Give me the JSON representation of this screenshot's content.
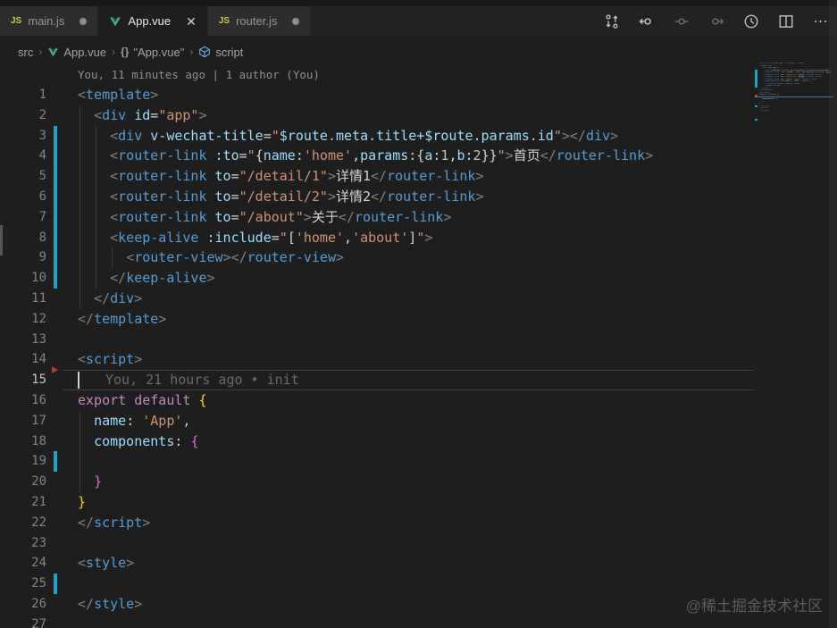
{
  "tabs": [
    {
      "label": "main.js",
      "icon": "js-icon",
      "state": "modified",
      "active": false
    },
    {
      "label": "App.vue",
      "icon": "vue-icon",
      "state": "open",
      "active": true
    },
    {
      "label": "router.js",
      "icon": "js-icon",
      "state": "modified",
      "active": false
    }
  ],
  "editor_actions": [
    {
      "name": "compare-changes"
    },
    {
      "name": "previous-change"
    },
    {
      "name": "change-disabled"
    },
    {
      "name": "next-change"
    },
    {
      "name": "timeline-history"
    },
    {
      "name": "split-editor"
    },
    {
      "name": "more-actions",
      "glyph": "⋯"
    }
  ],
  "breadcrumb": {
    "items": [
      {
        "label": "src",
        "icon": null
      },
      {
        "label": "App.vue",
        "icon": "vue-icon"
      },
      {
        "label": "\"App.vue\"",
        "icon": "braces-icon",
        "prefix": "{}"
      },
      {
        "label": "script",
        "icon": "symbol-module-icon"
      }
    ],
    "separator": "›"
  },
  "codelens_blame": "You, 11 minutes ago | 1 author (You)",
  "inline_blame_line15": "You, 21 hours ago • init",
  "watermark": "@稀土掘金技术社区",
  "colors": {
    "editor_bg": "#1e1e1e",
    "tab_inactive": "#2d2d2d",
    "tab_active": "#1e1e1e",
    "modified_gutter": "#1ea3c4",
    "deleted_gutter": "#b73b31",
    "tag": "#569cd6",
    "attr": "#9cdcfe",
    "string": "#ce9178",
    "keyword": "#c586c0",
    "number": "#b5cea8",
    "punct": "#808080",
    "vue_green": "#41b883",
    "js_yellow": "#cbcb41",
    "minimap_curline": "#2b7cb8"
  },
  "code": {
    "modified_lines": [
      3,
      4,
      5,
      6,
      7,
      8,
      9,
      10,
      19,
      25
    ],
    "deleted_marker_line": 15,
    "current_line": 15,
    "indent_guides": [
      {
        "col": 0,
        "from": 2,
        "to": 11
      },
      {
        "col": 2,
        "from": 3,
        "to": 10
      },
      {
        "col": 4,
        "from": 9,
        "to": 9
      },
      {
        "col": 0,
        "from": 17,
        "to": 20
      }
    ],
    "lines": [
      {
        "n": 1,
        "tokens": [
          [
            "p",
            "<"
          ],
          [
            "tag",
            "template"
          ],
          [
            "p",
            ">"
          ]
        ]
      },
      {
        "n": 2,
        "tokens": [
          [
            "op",
            "  "
          ],
          [
            "p",
            "<"
          ],
          [
            "tag",
            "div"
          ],
          [
            "op",
            " "
          ],
          [
            "attr",
            "id"
          ],
          [
            "op",
            "="
          ],
          [
            "str",
            "\"app\""
          ],
          [
            "p",
            ">"
          ]
        ]
      },
      {
        "n": 3,
        "tokens": [
          [
            "op",
            "    "
          ],
          [
            "p",
            "<"
          ],
          [
            "tag",
            "div"
          ],
          [
            "op",
            " "
          ],
          [
            "attr",
            "v-wechat-title"
          ],
          [
            "op",
            "="
          ],
          [
            "str",
            "\""
          ],
          [
            "attr",
            "$route.meta.title+$route.params.id"
          ],
          [
            "str",
            "\""
          ],
          [
            "p",
            "></"
          ],
          [
            "tag",
            "div"
          ],
          [
            "p",
            ">"
          ]
        ]
      },
      {
        "n": 4,
        "tokens": [
          [
            "op",
            "    "
          ],
          [
            "p",
            "<"
          ],
          [
            "tag",
            "router-link"
          ],
          [
            "op",
            " "
          ],
          [
            "attr",
            ":to"
          ],
          [
            "op",
            "="
          ],
          [
            "str",
            "\""
          ],
          [
            "op",
            "{"
          ],
          [
            "attr",
            "name"
          ],
          [
            "op",
            ":"
          ],
          [
            "str",
            "'home'"
          ],
          [
            "op",
            ","
          ],
          [
            "attr",
            "params"
          ],
          [
            "op",
            ":{"
          ],
          [
            "attr",
            "a"
          ],
          [
            "op",
            ":"
          ],
          [
            "num",
            "1"
          ],
          [
            "op",
            ","
          ],
          [
            "attr",
            "b"
          ],
          [
            "op",
            ":"
          ],
          [
            "num",
            "2"
          ],
          [
            "op",
            "}}"
          ],
          [
            "str",
            "\""
          ],
          [
            "p",
            ">"
          ],
          [
            "txt",
            "首页"
          ],
          [
            "p",
            "</"
          ],
          [
            "tag",
            "router-link"
          ],
          [
            "p",
            ">"
          ]
        ]
      },
      {
        "n": 5,
        "tokens": [
          [
            "op",
            "    "
          ],
          [
            "p",
            "<"
          ],
          [
            "tag",
            "router-link"
          ],
          [
            "op",
            " "
          ],
          [
            "attr",
            "to"
          ],
          [
            "op",
            "="
          ],
          [
            "str",
            "\"/detail/1\""
          ],
          [
            "p",
            ">"
          ],
          [
            "txt",
            "详情1"
          ],
          [
            "p",
            "</"
          ],
          [
            "tag",
            "router-link"
          ],
          [
            "p",
            ">"
          ]
        ]
      },
      {
        "n": 6,
        "tokens": [
          [
            "op",
            "    "
          ],
          [
            "p",
            "<"
          ],
          [
            "tag",
            "router-link"
          ],
          [
            "op",
            " "
          ],
          [
            "attr",
            "to"
          ],
          [
            "op",
            "="
          ],
          [
            "str",
            "\"/detail/2\""
          ],
          [
            "p",
            ">"
          ],
          [
            "txt",
            "详情2"
          ],
          [
            "p",
            "</"
          ],
          [
            "tag",
            "router-link"
          ],
          [
            "p",
            ">"
          ]
        ]
      },
      {
        "n": 7,
        "tokens": [
          [
            "op",
            "    "
          ],
          [
            "p",
            "<"
          ],
          [
            "tag",
            "router-link"
          ],
          [
            "op",
            " "
          ],
          [
            "attr",
            "to"
          ],
          [
            "op",
            "="
          ],
          [
            "str",
            "\"/about\""
          ],
          [
            "p",
            ">"
          ],
          [
            "txt",
            "关于"
          ],
          [
            "p",
            "</"
          ],
          [
            "tag",
            "router-link"
          ],
          [
            "p",
            ">"
          ]
        ]
      },
      {
        "n": 8,
        "tokens": [
          [
            "op",
            "    "
          ],
          [
            "p",
            "<"
          ],
          [
            "tag",
            "keep-alive"
          ],
          [
            "op",
            " "
          ],
          [
            "attr",
            ":include"
          ],
          [
            "op",
            "="
          ],
          [
            "str",
            "\""
          ],
          [
            "op",
            "["
          ],
          [
            "str",
            "'home'"
          ],
          [
            "op",
            ","
          ],
          [
            "str",
            "'about'"
          ],
          [
            "op",
            "]"
          ],
          [
            "str",
            "\""
          ],
          [
            "p",
            ">"
          ]
        ]
      },
      {
        "n": 9,
        "tokens": [
          [
            "op",
            "      "
          ],
          [
            "p",
            "<"
          ],
          [
            "tag",
            "router-view"
          ],
          [
            "p",
            "></"
          ],
          [
            "tag",
            "router-view"
          ],
          [
            "p",
            ">"
          ]
        ]
      },
      {
        "n": 10,
        "tokens": [
          [
            "op",
            "    "
          ],
          [
            "p",
            "</"
          ],
          [
            "tag",
            "keep-alive"
          ],
          [
            "p",
            ">"
          ]
        ]
      },
      {
        "n": 11,
        "tokens": [
          [
            "op",
            "  "
          ],
          [
            "p",
            "</"
          ],
          [
            "tag",
            "div"
          ],
          [
            "p",
            ">"
          ]
        ]
      },
      {
        "n": 12,
        "tokens": [
          [
            "p",
            "</"
          ],
          [
            "tag",
            "template"
          ],
          [
            "p",
            ">"
          ]
        ]
      },
      {
        "n": 13,
        "tokens": []
      },
      {
        "n": 14,
        "tokens": [
          [
            "p",
            "<"
          ],
          [
            "tag",
            "script"
          ],
          [
            "p",
            ">"
          ]
        ]
      },
      {
        "n": 15,
        "tokens": []
      },
      {
        "n": 16,
        "tokens": [
          [
            "kw",
            "export"
          ],
          [
            "op",
            " "
          ],
          [
            "kw",
            "default"
          ],
          [
            "op",
            " "
          ],
          [
            "b1",
            "{"
          ]
        ]
      },
      {
        "n": 17,
        "tokens": [
          [
            "op",
            "  "
          ],
          [
            "attr",
            "name"
          ],
          [
            "op",
            ": "
          ],
          [
            "str",
            "'App'"
          ],
          [
            "op",
            ","
          ]
        ]
      },
      {
        "n": 18,
        "tokens": [
          [
            "op",
            "  "
          ],
          [
            "attr",
            "components"
          ],
          [
            "op",
            ": "
          ],
          [
            "b2",
            "{"
          ]
        ]
      },
      {
        "n": 19,
        "tokens": []
      },
      {
        "n": 20,
        "tokens": [
          [
            "op",
            "  "
          ],
          [
            "b2",
            "}"
          ]
        ]
      },
      {
        "n": 21,
        "tokens": [
          [
            "b1",
            "}"
          ]
        ]
      },
      {
        "n": 22,
        "tokens": [
          [
            "p",
            "</"
          ],
          [
            "tag",
            "script"
          ],
          [
            "p",
            ">"
          ]
        ]
      },
      {
        "n": 23,
        "tokens": []
      },
      {
        "n": 24,
        "tokens": [
          [
            "p",
            "<"
          ],
          [
            "tag",
            "style"
          ],
          [
            "p",
            ">"
          ]
        ]
      },
      {
        "n": 25,
        "tokens": []
      },
      {
        "n": 26,
        "tokens": [
          [
            "p",
            "</"
          ],
          [
            "tag",
            "style"
          ],
          [
            "p",
            ">"
          ]
        ]
      },
      {
        "n": 27,
        "tokens": []
      }
    ]
  }
}
